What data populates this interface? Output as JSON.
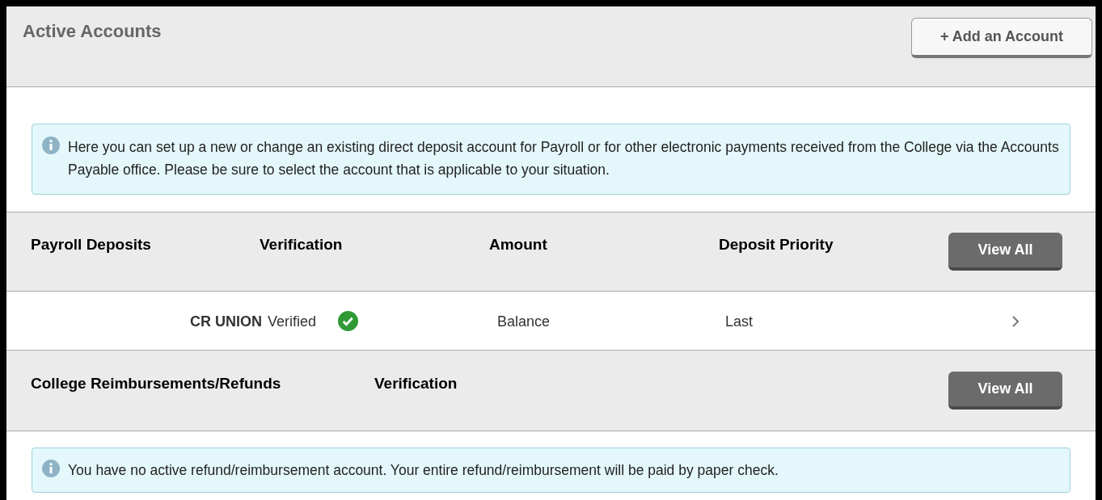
{
  "header": {
    "title": "Active Accounts",
    "add_button": "+ Add an Account"
  },
  "intro_notice": "Here you can set up a new or change an existing direct deposit account for Payroll or for other electronic payments received from the College via the Accounts Payable office. Please be sure to select the account that is applicable to your situation.",
  "payroll": {
    "columns": [
      "Payroll Deposits",
      "Verification",
      "Amount",
      "Deposit Priority"
    ],
    "button": "View All",
    "rows": [
      {
        "account": "CR UNION",
        "verification": "Verified",
        "verified": true,
        "amount": "Balance",
        "priority": "Last"
      }
    ]
  },
  "reimbursements": {
    "columns": [
      "College Reimbursements/Refunds",
      "Verification"
    ],
    "button": "View All",
    "notice": "You have no active refund/reimbursement account. Your entire refund/reimbursement will be paid by paper check."
  }
}
